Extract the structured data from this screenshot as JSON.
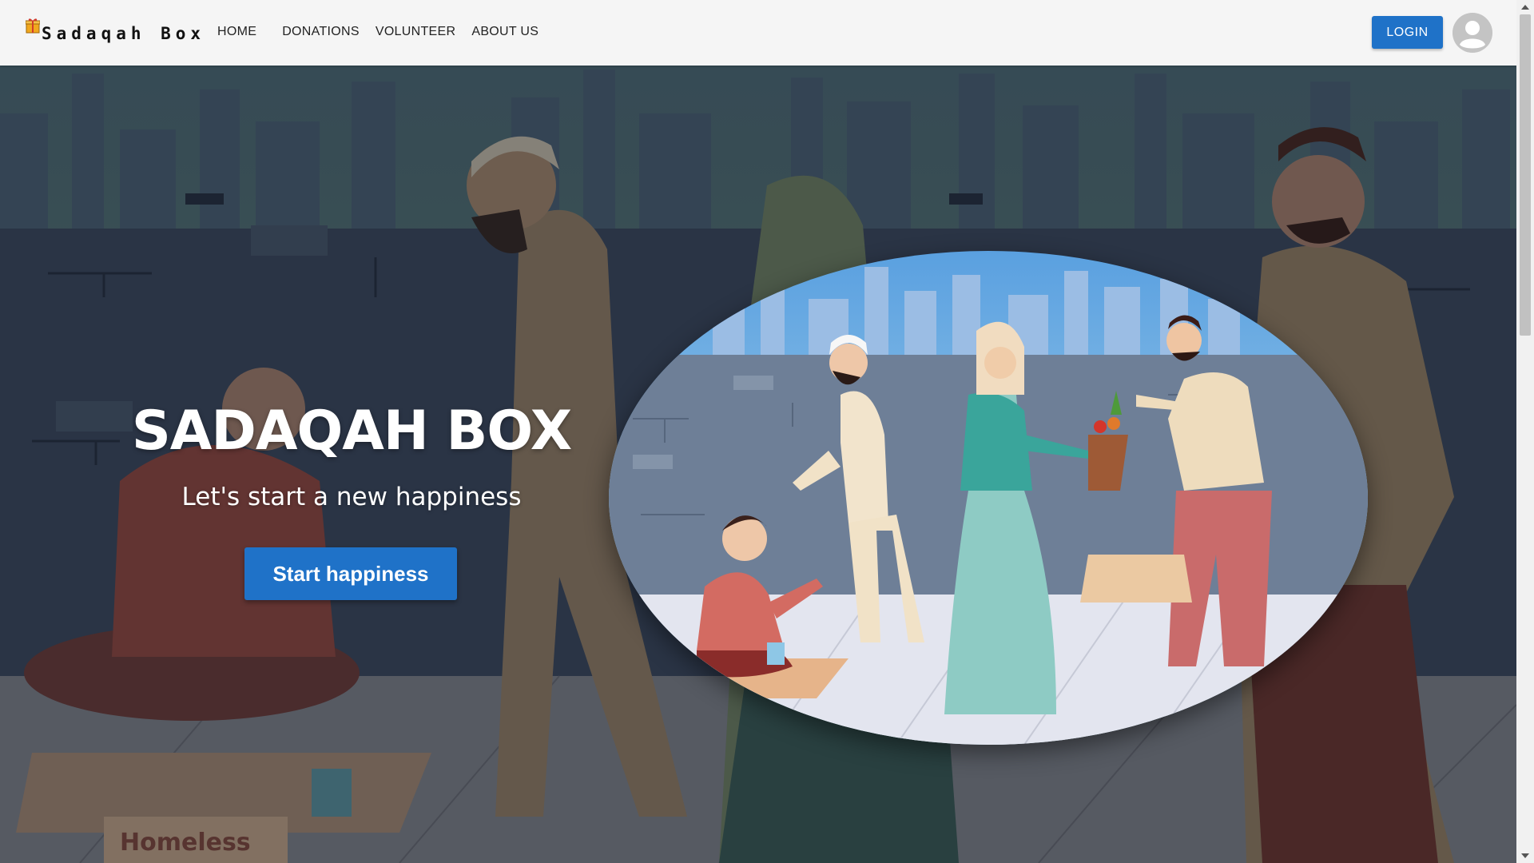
{
  "nav": {
    "brand": "Sadaqah Box",
    "links": [
      "HOME",
      "DONATIONS",
      "VOLUNTEER",
      "ABOUT US"
    ],
    "login_label": "LOGIN"
  },
  "hero": {
    "title": "SADAQAH BOX",
    "subtitle": "Let's start a new happiness",
    "cta_label": "Start happiness",
    "sign_text": "Homeless"
  },
  "icons": {
    "brand": "gift-box-icon",
    "avatar": "user-avatar-icon"
  },
  "colors": {
    "primary": "#1f72c8",
    "nav_bg": "#f5f5f5"
  }
}
